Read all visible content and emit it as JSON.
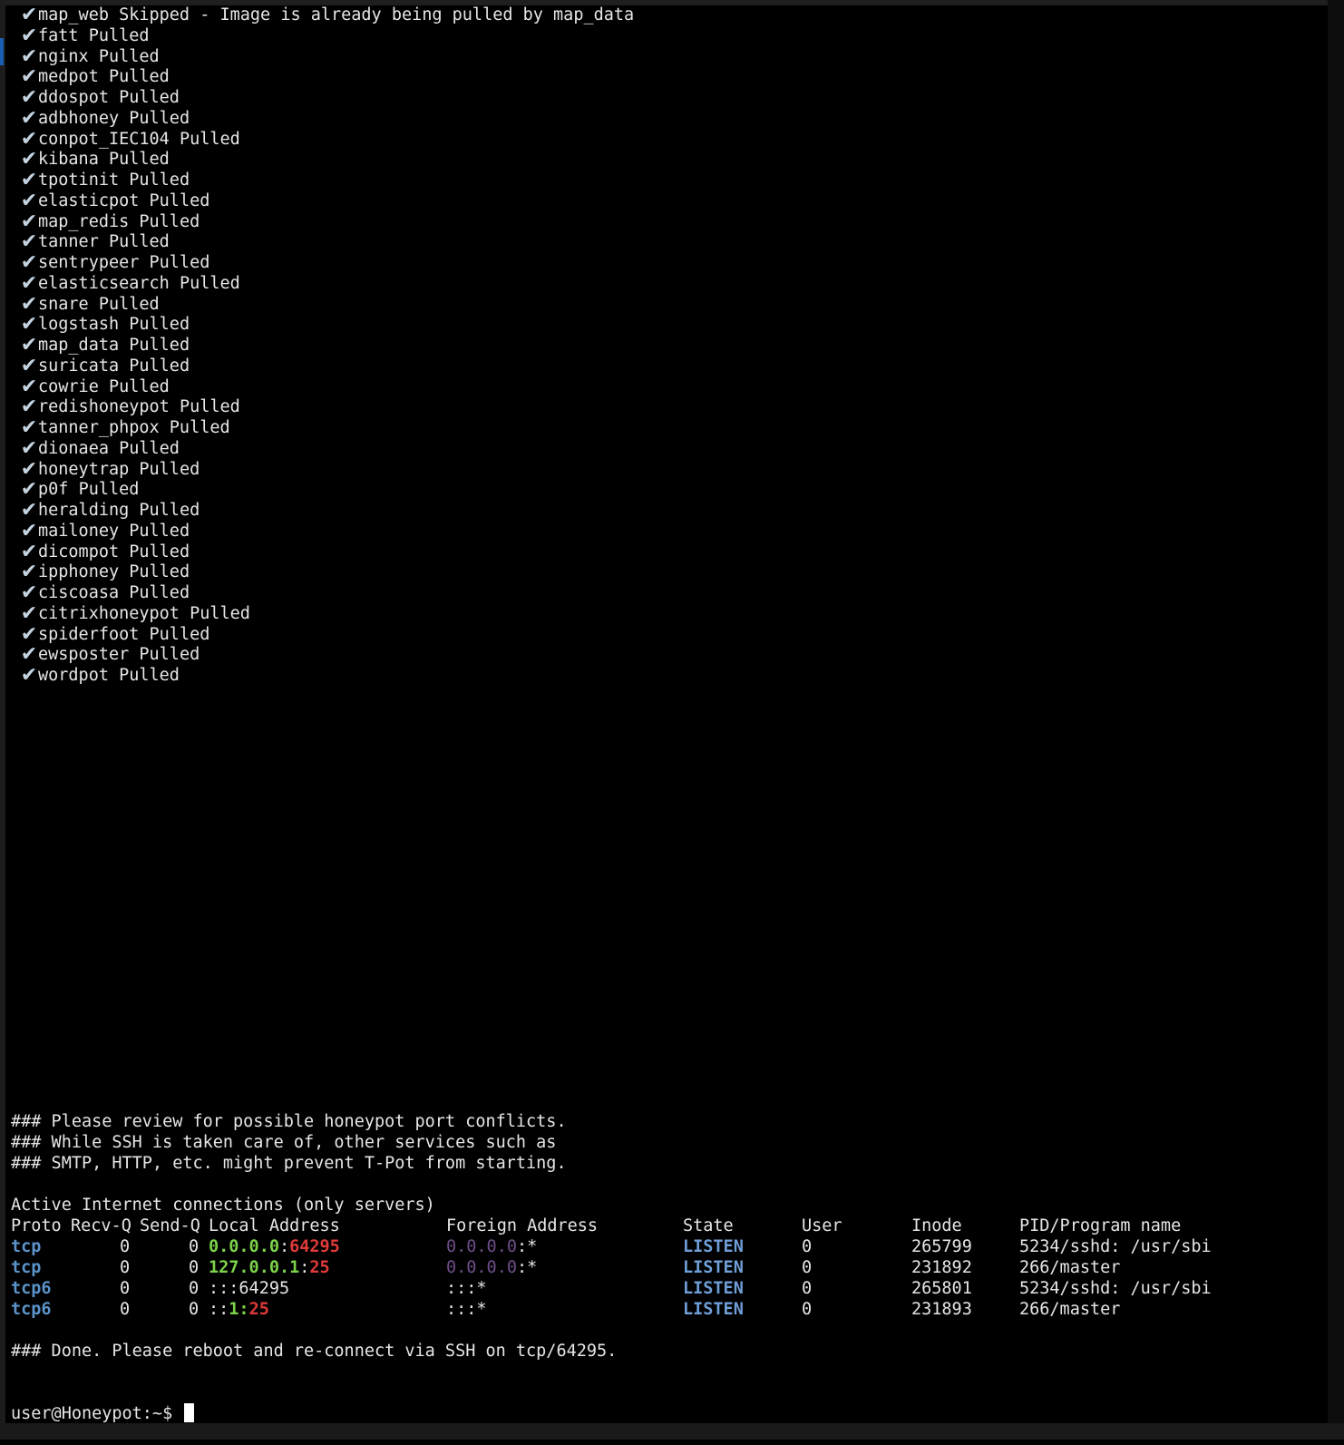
{
  "pull_list": [
    {
      "name": "map_web",
      "status": "Skipped - Image is already being pulled by map_data"
    },
    {
      "name": "fatt",
      "status": "Pulled"
    },
    {
      "name": "nginx",
      "status": "Pulled"
    },
    {
      "name": "medpot",
      "status": "Pulled"
    },
    {
      "name": "ddospot",
      "status": "Pulled"
    },
    {
      "name": "adbhoney",
      "status": "Pulled"
    },
    {
      "name": "conpot_IEC104",
      "status": "Pulled"
    },
    {
      "name": "kibana",
      "status": "Pulled"
    },
    {
      "name": "tpotinit",
      "status": "Pulled"
    },
    {
      "name": "elasticpot",
      "status": "Pulled"
    },
    {
      "name": "map_redis",
      "status": "Pulled"
    },
    {
      "name": "tanner",
      "status": "Pulled"
    },
    {
      "name": "sentrypeer",
      "status": "Pulled"
    },
    {
      "name": "elasticsearch",
      "status": "Pulled"
    },
    {
      "name": "snare",
      "status": "Pulled"
    },
    {
      "name": "logstash",
      "status": "Pulled"
    },
    {
      "name": "map_data",
      "status": "Pulled"
    },
    {
      "name": "suricata",
      "status": "Pulled"
    },
    {
      "name": "cowrie",
      "status": "Pulled"
    },
    {
      "name": "redishoneypot",
      "status": "Pulled"
    },
    {
      "name": "tanner_phpox",
      "status": "Pulled"
    },
    {
      "name": "dionaea",
      "status": "Pulled"
    },
    {
      "name": "honeytrap",
      "status": "Pulled"
    },
    {
      "name": "p0f",
      "status": "Pulled"
    },
    {
      "name": "heralding",
      "status": "Pulled"
    },
    {
      "name": "mailoney",
      "status": "Pulled"
    },
    {
      "name": "dicompot",
      "status": "Pulled"
    },
    {
      "name": "ipphoney",
      "status": "Pulled"
    },
    {
      "name": "ciscoasa",
      "status": "Pulled"
    },
    {
      "name": "citrixhoneypot",
      "status": "Pulled"
    },
    {
      "name": "spiderfoot",
      "status": "Pulled"
    },
    {
      "name": "ewsposter",
      "status": "Pulled"
    },
    {
      "name": "wordpot",
      "status": "Pulled"
    }
  ],
  "check_glyph": "✔",
  "review_notes": [
    "### Please review for possible honeypot port conflicts.",
    "### While SSH is taken care of, other services such as",
    "### SMTP, HTTP, etc. might prevent T-Pot from starting."
  ],
  "netstat": {
    "title": "Active Internet connections (only servers)",
    "headers": {
      "proto": "Proto",
      "recvq": "Recv-Q",
      "sendq": "Send-Q",
      "local": "Local Address",
      "foreign": "Foreign Address",
      "state": "State",
      "user": "User",
      "inode": "Inode",
      "program": "PID/Program name"
    },
    "rows": [
      {
        "proto": "tcp",
        "recvq": "0",
        "sendq": "0",
        "local_host": "0.0.0.0",
        "local_sep": ":",
        "local_port": "64295",
        "foreign_host": "0.0.0.0",
        "foreign_rest": ":*",
        "state": "LISTEN",
        "user": "0",
        "inode": "265799",
        "program": "5234/sshd: /usr/sbi"
      },
      {
        "proto": "tcp",
        "recvq": "0",
        "sendq": "0",
        "local_host": "127.0.0.1",
        "local_sep": ":",
        "local_port": "25",
        "foreign_host": "0.0.0.0",
        "foreign_rest": ":*",
        "state": "LISTEN",
        "user": "0",
        "inode": "231892",
        "program": "266/master"
      },
      {
        "proto": "tcp6",
        "recvq": "0",
        "sendq": "0",
        "local_host": ":::64295",
        "local_sep": "",
        "local_port": "",
        "foreign_host": "",
        "foreign_rest": ":::*",
        "state": "LISTEN",
        "user": "0",
        "inode": "265801",
        "program": "5234/sshd: /usr/sbi"
      },
      {
        "proto": "tcp6",
        "recvq": "0",
        "sendq": "0",
        "local_host": "::",
        "local_sep": "1:",
        "local_port": "25",
        "foreign_host": "",
        "foreign_rest": ":::*",
        "state": "LISTEN",
        "user": "0",
        "inode": "231893",
        "program": "266/master"
      }
    ]
  },
  "done_message": "### Done. Please reboot and re-connect via SSH on tcp/64295.",
  "prompt": "user@Honeypot:~$ ",
  "colors": {
    "background": "#000000",
    "text": "#e6e6e6",
    "proto": "#5b93c9",
    "state": "#6f9fd8",
    "address_green": "#7cd34a",
    "port_red": "#e03a3a",
    "foreign_dim": "#6e4e8a"
  }
}
